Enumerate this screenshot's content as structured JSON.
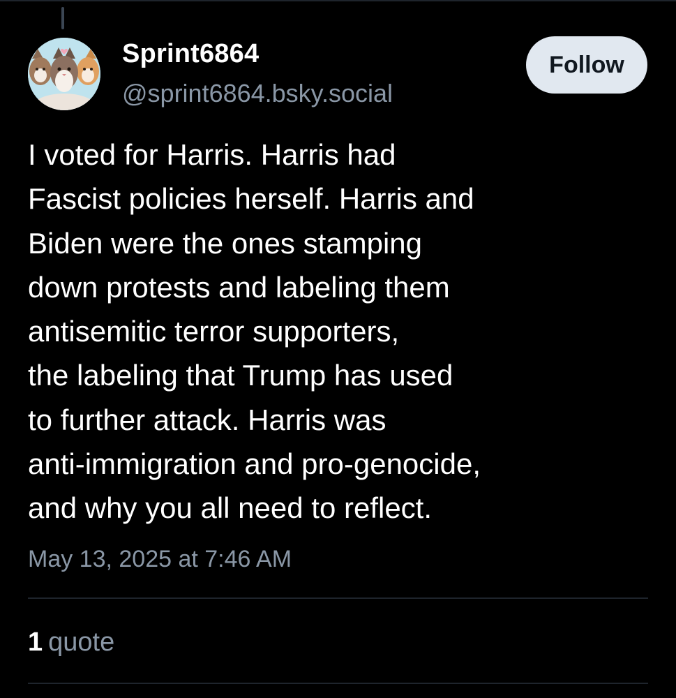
{
  "post": {
    "author": {
      "display_name": "Sprint6864",
      "handle": "@sprint6864.bsky.social"
    },
    "follow_label": "Follow",
    "text_lines": [
      "I voted for Harris. Harris had",
      "Fascist policies herself. Harris and",
      "Biden were the ones stamping",
      "down protests and labeling them",
      "antisemitic terror supporters,",
      "the labeling that Trump has used",
      "to further attack. Harris was",
      "anti-immigration and pro-genocide,",
      "and why you all need to reflect."
    ],
    "timestamp": "May 13, 2025 at 7:46 AM",
    "stats": {
      "quote_count": "1",
      "quote_label": "quote"
    }
  },
  "colors": {
    "background": "#000000",
    "text": "#ffffff",
    "muted": "#8a97a6",
    "button_bg": "#e1e8f0",
    "divider": "#1e242c"
  }
}
